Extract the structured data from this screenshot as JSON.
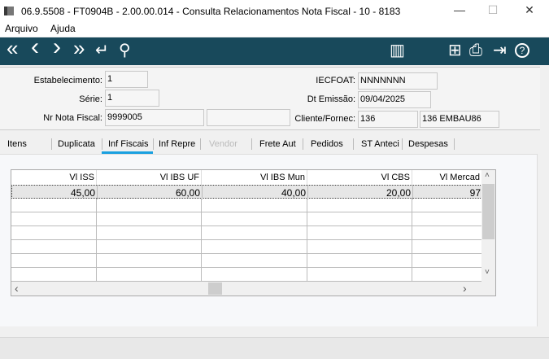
{
  "window": {
    "title": "06.9.5508 - FT0904B - 2.00.00.014 - Consulta Relacionamentos Nota Fiscal - 10 - 8183",
    "minimize": "—",
    "maximize": "☐",
    "close": "✕"
  },
  "menu": [
    "Arquivo",
    "Ajuda"
  ],
  "toolbar": {
    "first": "«",
    "prev": "‹",
    "next": "›",
    "last": "»",
    "return": "↵",
    "search": "⚲",
    "chart": "▥",
    "tree": "⊞",
    "print": "⎙",
    "exit": "⇥",
    "help": "?"
  },
  "form": {
    "estabelecimento": {
      "label": "Estabelecimento:",
      "value": "1"
    },
    "serie": {
      "label": "Série:",
      "value": "1"
    },
    "nr_nota": {
      "label": "Nr Nota Fiscal:",
      "value": "9999005",
      "extra": ""
    },
    "iecfoat": {
      "label": "IECFOAT:",
      "value": "NNNNNNN"
    },
    "dt_emissao": {
      "label": "Dt Emissão:",
      "value": "09/04/2025"
    },
    "cliente": {
      "label": "Cliente/Fornec:",
      "code": "136",
      "name": "136 EMBAU86"
    }
  },
  "tabs": [
    "Itens",
    "Duplicata",
    "Inf Fiscais",
    "Inf Repre",
    "Vendor",
    "Frete Aut",
    "Pedidos",
    "ST Anteci",
    "Despesas"
  ],
  "active_tab": "Inf Fiscais",
  "grid": {
    "columns": [
      "Vl ISS",
      "Vl IBS UF",
      "Vl IBS Mun",
      "Vl CBS",
      "Vl Mercad"
    ],
    "rows": [
      [
        "45,00",
        "60,00",
        "40,00",
        "20,00",
        "97"
      ]
    ],
    "scroll_up": "˄",
    "scroll_down": "˅",
    "scroll_left": "‹",
    "scroll_right": "›"
  }
}
